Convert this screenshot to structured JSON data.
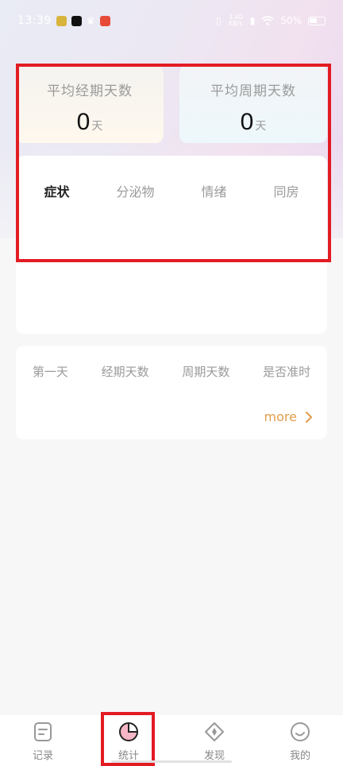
{
  "status_bar": {
    "time": "13:39",
    "net_speed": "3.40 KB/s",
    "battery": "50%"
  },
  "stats": {
    "avg_period_days": {
      "title": "平均经期天数",
      "value": "0",
      "unit": "天"
    },
    "avg_cycle_days": {
      "title": "平均周期天数",
      "value": "0",
      "unit": "天"
    }
  },
  "tabs": [
    {
      "label": "症状",
      "active": true
    },
    {
      "label": "分泌物",
      "active": false
    },
    {
      "label": "情绪",
      "active": false
    },
    {
      "label": "同房",
      "active": false
    }
  ],
  "table": {
    "columns": [
      "第一天",
      "经期天数",
      "周期天数",
      "是否准时"
    ],
    "more_label": "more"
  },
  "bottom_nav": [
    {
      "label": "记录",
      "icon": "record-icon",
      "active": false
    },
    {
      "label": "统计",
      "icon": "stats-pie-icon",
      "active": true
    },
    {
      "label": "发现",
      "icon": "compass-icon",
      "active": false
    },
    {
      "label": "我的",
      "icon": "profile-icon",
      "active": false
    }
  ],
  "colors": {
    "accent_orange": "#e39c4c",
    "highlight_red": "#e31b23",
    "stats_pink": "#f08aa8"
  }
}
